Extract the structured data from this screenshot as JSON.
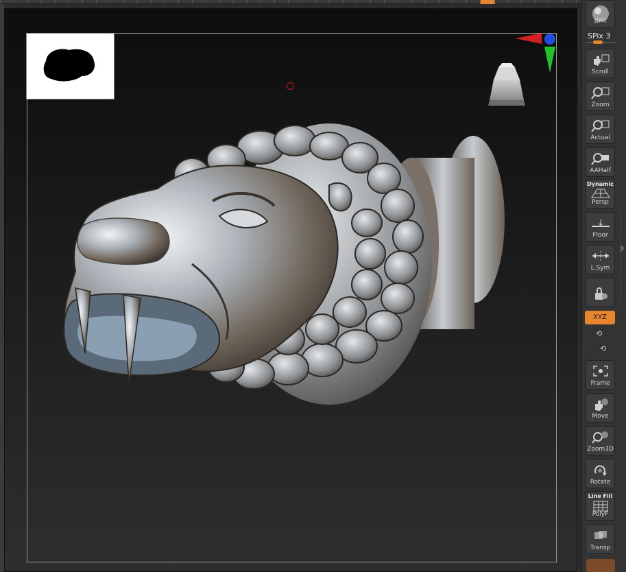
{
  "toolbar": {
    "spix_label": "SPix",
    "spix_value": "3",
    "buttons": {
      "bpr": "BPR",
      "scroll": "Scroll",
      "zoom": "Zoom",
      "actual": "Actual",
      "aahalf": "AAHalf",
      "persp_title": "Dynamic",
      "persp": "Persp",
      "floor": "Floor",
      "lsym": "L.Sym",
      "xyz": "XYZ",
      "frame": "Frame",
      "move": "Move",
      "zoom3d": "Zoom3D",
      "rotate": "Rotate",
      "polyf_title": "Line Fill",
      "polyf": "PolyF",
      "transp": "Transp"
    }
  },
  "colors": {
    "accent": "#e8852e",
    "gizmo_x": "#d32020",
    "gizmo_y": "#22c22a",
    "gizmo_z": "#1f4fe0"
  },
  "icons": {
    "cursor": "circle-cursor-icon",
    "gizmo": "axis-gizmo-icon",
    "navcube": "nav-cube-icon"
  }
}
